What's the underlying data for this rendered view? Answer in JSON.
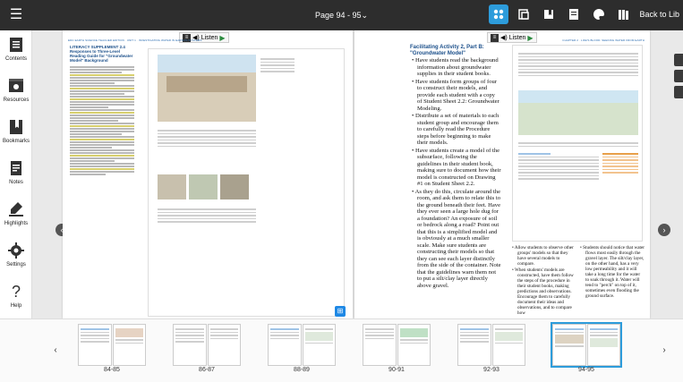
{
  "topbar": {
    "page_indicator": "Page 94 - 95⌄",
    "back_label": "Back to Lib",
    "icons": [
      "layout-icon",
      "tabs-icon",
      "bookmark-icon",
      "notes-icon",
      "palette-icon",
      "library-icon"
    ]
  },
  "sidebar": {
    "items": [
      {
        "label": "Contents",
        "icon": "contents-icon"
      },
      {
        "label": "Resources",
        "icon": "resources-icon"
      },
      {
        "label": "Bookmarks",
        "icon": "bookmarks-icon"
      },
      {
        "label": "Notes",
        "icon": "notes-icon"
      },
      {
        "label": "Highlights",
        "icon": "highlights-icon"
      },
      {
        "label": "Settings",
        "icon": "settings-icon"
      },
      {
        "label": "Help",
        "icon": "help-icon"
      }
    ]
  },
  "listen": {
    "label": "Listen"
  },
  "left_page": {
    "running_head": "EDC EARTH SCIENCE TEACHER EDITION · UNIT 1 · INVESTIGATING WATER IN EARTH'S SYSTEMS",
    "title": "LITERACY SUPPLEMENT 2.4 Responses to Three-Level Reading Guide for \"Groundwater Model\" Background"
  },
  "right_page": {
    "running_head": "CHAPTER 2 · LIFE'S BLOOD: SEEKING WATER FROM EARTH",
    "activity_title": "Facilitating Activity 2, Part B: \"Groundwater Model\"",
    "bullets": [
      "Have students read the background information about groundwater supplies in their student books.",
      "Have students form groups of four to construct their models, and provide each student with a copy of Student Sheet 2.2: Groundwater Modeling.",
      "Distribute a set of materials to each student group and encourage them to carefully read the Procedure steps before beginning to make their models.",
      "Have students create a model of the subsurface, following the guidelines in their student book, making sure to document how their model is constructed on Drawing #1 on Student Sheet 2.2.",
      "As they do this, circulate around the room, and ask them to relate this to the ground beneath their feet. Have they ever seen a large hole dug for a foundation? An exposure of soil or bedrock along a road? Point out that this is a simplified model and is obviously at a much smaller scale. Make sure students are constructing their models so that they can see each layer distinctly from the side of the container. Note that the guidelines warn them not to put a silt/clay layer directly above gravel."
    ],
    "bottom_col1": [
      "Allow students to observe other groups' models so that they have several models to compare.",
      "When students' models are constructed, have them follow the steps of the procedure in their student books, making predictions and observations. Encourage them to carefully document their ideas and observations, and to compare how"
    ],
    "bottom_col2": [
      "Students should notice that water flows most easily through the gravel layer. The silt/clay layer, on the other hand, has a very low permeability and it will take a long time for the water to soak through it. Water will tend to \"perch\" on top of it, sometimes even flooding the ground surface."
    ]
  },
  "thumbnails": [
    {
      "label": "84-85",
      "selected": false
    },
    {
      "label": "86-87",
      "selected": false
    },
    {
      "label": "88-89",
      "selected": false
    },
    {
      "label": "90-91",
      "selected": false
    },
    {
      "label": "92-93",
      "selected": false
    },
    {
      "label": "94-95",
      "selected": true
    }
  ],
  "colors": {
    "accent": "#2d9cdb",
    "topbar": "#2d2d2d",
    "heading_blue": "#1b4f8a"
  }
}
